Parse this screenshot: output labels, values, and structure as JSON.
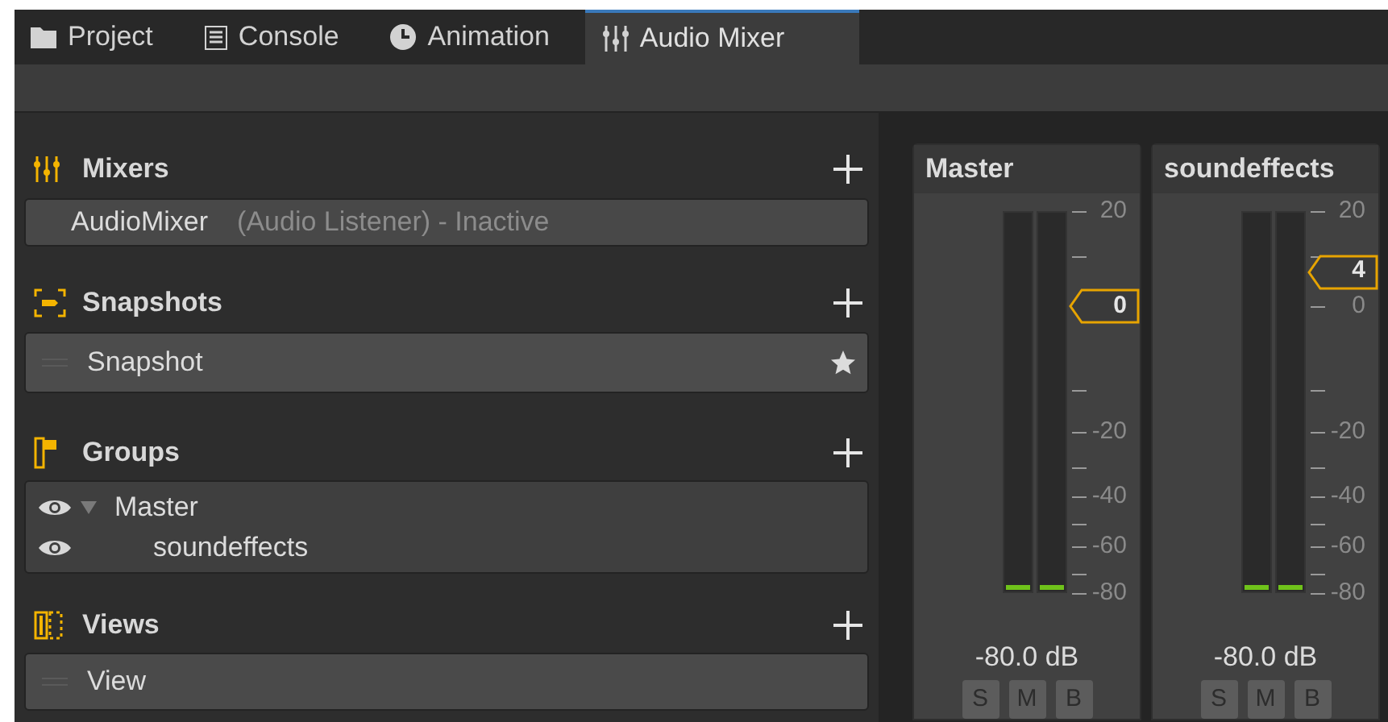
{
  "tabs": [
    {
      "label": "Project",
      "kind": "folder",
      "selected": false
    },
    {
      "label": "Console",
      "kind": "list",
      "selected": false
    },
    {
      "label": "Animation",
      "kind": "clock",
      "selected": false
    },
    {
      "label": "Audio Mixer",
      "kind": "sliders",
      "selected": true
    }
  ],
  "mixers": {
    "title": "Mixers",
    "items": [
      {
        "name": "AudioMixer",
        "note": "(Audio Listener) - Inactive"
      }
    ]
  },
  "snapshots": {
    "title": "Snapshots",
    "items": [
      {
        "name": "Snapshot"
      }
    ]
  },
  "groups": {
    "title": "Groups",
    "items": [
      {
        "name": "Master",
        "visible": true,
        "expanded": true,
        "children": [
          {
            "name": "soundeffects",
            "visible": true
          }
        ]
      }
    ]
  },
  "views": {
    "title": "Views",
    "items": [
      {
        "name": "View"
      }
    ]
  },
  "strips": [
    {
      "name": "Master",
      "fader": "0",
      "level": 0.75,
      "reading": "-80.0 dB",
      "ticks": [
        "20",
        "-20",
        "-40",
        "-60",
        "-80"
      ],
      "buttons": [
        {
          "label": "S",
          "on": false
        },
        {
          "label": "M",
          "on": false
        },
        {
          "label": "B",
          "on": false
        }
      ]
    },
    {
      "name": "soundeffects",
      "fader": "4",
      "level": 0.84,
      "reading": "-80.0 dB",
      "ticks": [
        "20",
        "0",
        "-20",
        "-40",
        "-60",
        "-80"
      ],
      "buttons": [
        {
          "label": "S",
          "on": false
        },
        {
          "label": "M",
          "on": false
        },
        {
          "label": "B",
          "on": false
        }
      ]
    }
  ]
}
